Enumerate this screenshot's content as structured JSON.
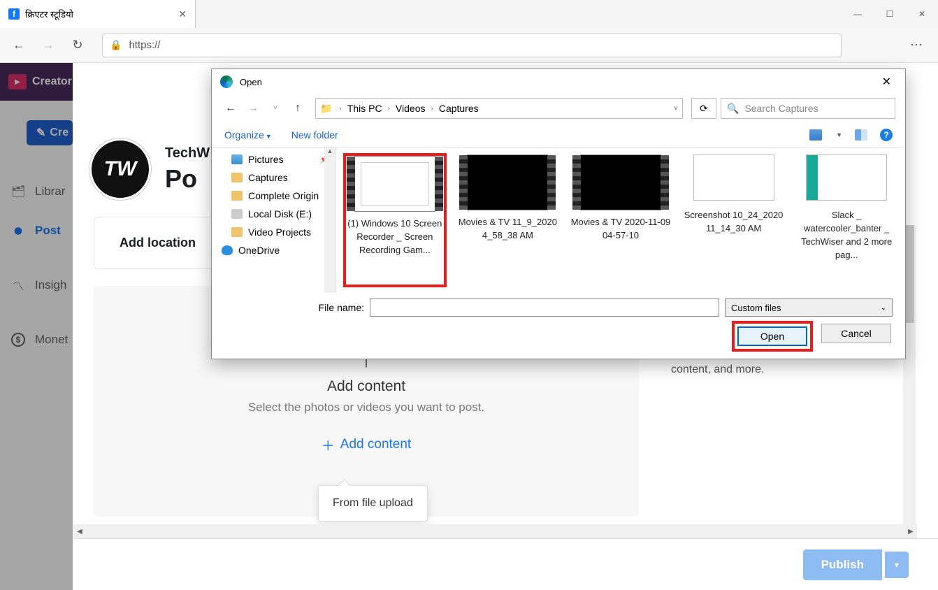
{
  "browser": {
    "tab_title": "क्रिएटर स्टूडियो",
    "url_prefix": "https://",
    "window_minimize": "—",
    "window_maximize": "☐",
    "window_close": "✕"
  },
  "sidebar": {
    "app_name": "Creator",
    "create_button": "Cre",
    "items": [
      {
        "icon": "🗂",
        "label": "Librar"
      },
      {
        "icon": "○",
        "label": "Post"
      },
      {
        "icon": "📈",
        "label": "Insigh"
      },
      {
        "icon": "$",
        "label": "Monet"
      }
    ]
  },
  "post_card": {
    "avatar_text": "TW",
    "page_name": "TechW",
    "heading": "Po",
    "add_location": "Add location",
    "upload_icon": "⤒",
    "upload_title": "Add content",
    "upload_subtitle": "Select the photos or videos you want to post.",
    "add_content_link": "Add content",
    "popover_text": "From file upload"
  },
  "right_panel": {
    "text": "content, and more."
  },
  "footer": {
    "publish": "Publish",
    "caret": "▾"
  },
  "file_dialog": {
    "title": "Open",
    "close": "✕",
    "nav": {
      "back": "←",
      "forward": "→",
      "hist": "˅",
      "up": "↑"
    },
    "breadcrumb": [
      "This PC",
      "Videos",
      "Captures"
    ],
    "refresh": "⟳",
    "search_placeholder": "Search Captures",
    "organize": "Organize",
    "new_folder": "New folder",
    "help": "?",
    "tree": [
      {
        "type": "pictures",
        "label": "Pictures",
        "pinned": true
      },
      {
        "type": "folder",
        "label": "Captures"
      },
      {
        "type": "folder",
        "label": "Complete Origin"
      },
      {
        "type": "disk",
        "label": "Local Disk (E:)"
      },
      {
        "type": "folder",
        "label": "Video Projects"
      },
      {
        "type": "onedrive",
        "label": "OneDrive"
      }
    ],
    "files": [
      {
        "name": "(1) Windows 10 Screen Recorder _ Screen Recording Gam...",
        "kind": "video-light",
        "highlighted": true
      },
      {
        "name": "Movies & TV 11_9_2020 4_58_38 AM",
        "kind": "video-dark"
      },
      {
        "name": "Movies & TV 2020-11-09 04-57-10",
        "kind": "video-dark"
      },
      {
        "name": "Screenshot 10_24_2020 11_14_30 AM",
        "kind": "image"
      },
      {
        "name": "Slack _ watercooler_banter _ TechWiser and 2 more pag...",
        "kind": "image-teal"
      }
    ],
    "file_name_label": "File name:",
    "filter": "Custom files",
    "open_btn": "Open",
    "cancel_btn": "Cancel"
  }
}
